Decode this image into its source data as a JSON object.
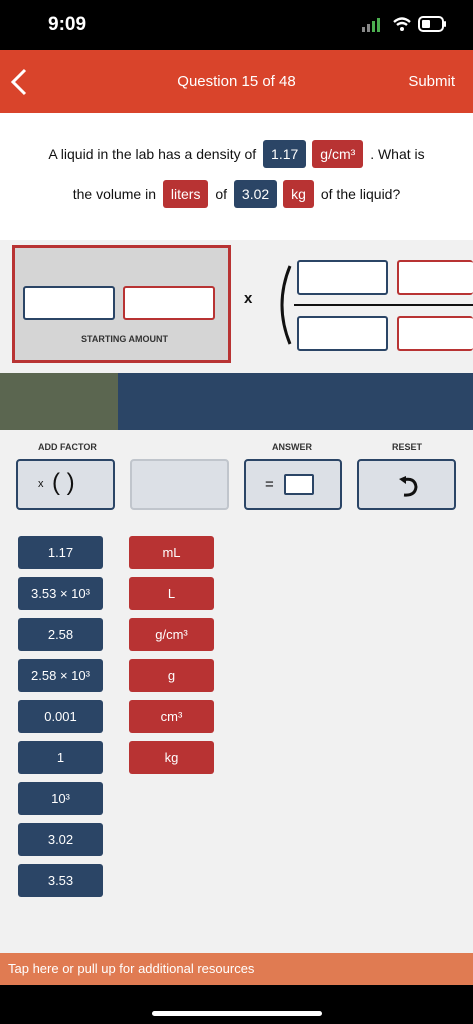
{
  "status": {
    "time": "9:09"
  },
  "header": {
    "title": "Question 15 of 48",
    "submit": "Submit"
  },
  "question": {
    "line1_pre": "A liquid in the lab has a density of",
    "density_value": "1.17",
    "density_unit": "g/cm³",
    "line1_post": ". What is",
    "line2_pre": "the volume in",
    "target_unit": "liters",
    "line2_of": "of",
    "mass_value": "3.02",
    "mass_unit": "kg",
    "line2_post": "of the liquid?"
  },
  "workarea": {
    "starting_amount_label": "STARTING AMOUNT",
    "multiply": "x"
  },
  "controls": {
    "add_factor_label": "ADD FACTOR",
    "add_factor_symbol": "x",
    "answer_label": "ANSWER",
    "equals": "=",
    "reset_label": "RESET"
  },
  "value_tiles": [
    "1.17",
    "3.53 × 10³",
    "2.58",
    "2.58 × 10³",
    "0.001",
    "1",
    "10³",
    "3.02",
    "3.53"
  ],
  "unit_tiles": [
    "mL",
    "L",
    "g/cm³",
    "g",
    "cm³",
    "kg"
  ],
  "resources": {
    "text": "Tap here or pull up for additional resources"
  },
  "colors": {
    "header": "#d9442b",
    "blue_tile": "#2b4566",
    "red_tile": "#b83333",
    "resources_bar": "#e07b52"
  }
}
